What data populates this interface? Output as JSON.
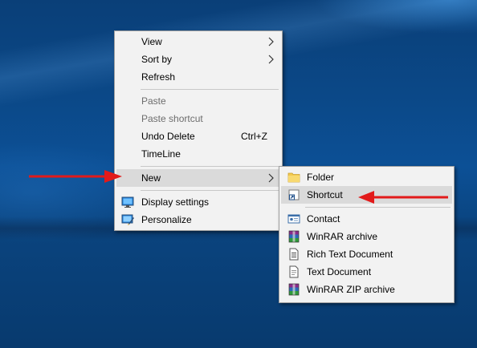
{
  "main_menu": {
    "items": [
      {
        "label": "View"
      },
      {
        "label": "Sort by"
      },
      {
        "label": "Refresh"
      },
      {
        "label": "Paste"
      },
      {
        "label": "Paste shortcut"
      },
      {
        "label": "Undo Delete",
        "shortcut": "Ctrl+Z"
      },
      {
        "label": "TimeLine"
      },
      {
        "label": "New"
      },
      {
        "label": "Display settings",
        "icon": "display-settings-icon"
      },
      {
        "label": "Personalize",
        "icon": "personalize-icon"
      }
    ]
  },
  "new_submenu": {
    "items": [
      {
        "label": "Folder",
        "icon": "folder-icon"
      },
      {
        "label": "Shortcut",
        "icon": "shortcut-icon"
      },
      {
        "label": "Contact",
        "icon": "contact-card-icon"
      },
      {
        "label": "WinRAR archive",
        "icon": "winrar-archive-icon"
      },
      {
        "label": "Rich Text Document",
        "icon": "document-icon"
      },
      {
        "label": "Text Document",
        "icon": "text-document-icon"
      },
      {
        "label": "WinRAR ZIP archive",
        "icon": "winrar-zip-icon"
      }
    ]
  },
  "colors": {
    "annotation_arrow": "#e21a1a",
    "menu_background": "#f2f2f2",
    "highlight": "#dadada",
    "disabled_text": "#6d6d6d"
  }
}
